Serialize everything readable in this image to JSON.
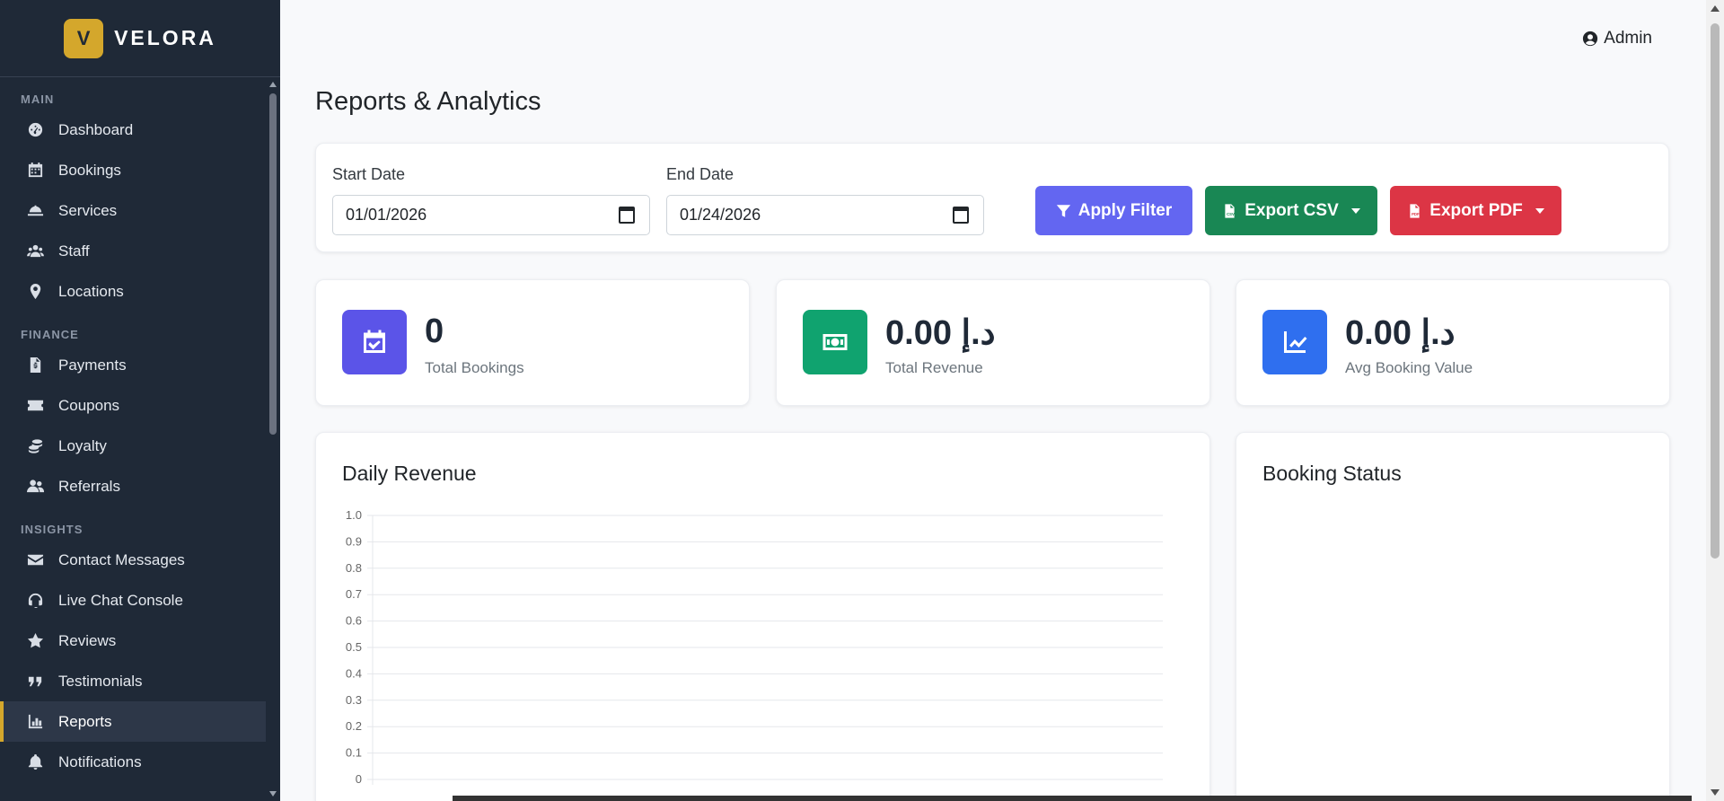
{
  "brand": {
    "logo_letter": "V",
    "name": "VELORA",
    "accent": "#d4a72c"
  },
  "sidebar": {
    "sections": [
      {
        "title": "MAIN",
        "items": [
          {
            "label": "Dashboard",
            "icon": "gauge-icon"
          },
          {
            "label": "Bookings",
            "icon": "calendar-icon"
          },
          {
            "label": "Services",
            "icon": "concierge-bell-icon"
          },
          {
            "label": "Staff",
            "icon": "users-icon"
          },
          {
            "label": "Locations",
            "icon": "map-pin-icon"
          }
        ]
      },
      {
        "title": "FINANCE",
        "items": [
          {
            "label": "Payments",
            "icon": "invoice-icon"
          },
          {
            "label": "Coupons",
            "icon": "ticket-icon"
          },
          {
            "label": "Loyalty",
            "icon": "coins-icon"
          },
          {
            "label": "Referrals",
            "icon": "user-friends-icon"
          }
        ]
      },
      {
        "title": "INSIGHTS",
        "items": [
          {
            "label": "Contact Messages",
            "icon": "envelope-icon"
          },
          {
            "label": "Live Chat Console",
            "icon": "headset-icon"
          },
          {
            "label": "Reviews",
            "icon": "star-icon"
          },
          {
            "label": "Testimonials",
            "icon": "quote-icon"
          },
          {
            "label": "Reports",
            "icon": "bar-chart-icon",
            "active": true
          },
          {
            "label": "Notifications",
            "icon": "bell-icon"
          }
        ]
      }
    ]
  },
  "topbar": {
    "user_label": "Admin"
  },
  "page": {
    "title": "Reports & Analytics"
  },
  "filter": {
    "start_label": "Start Date",
    "start_value": "01/01/2026",
    "end_label": "End Date",
    "end_value": "01/24/2026",
    "apply_label": "Apply Filter",
    "csv_label": "Export CSV",
    "pdf_label": "Export PDF",
    "colors": {
      "apply": "#6366f1",
      "csv": "#198754",
      "pdf": "#dc3545"
    }
  },
  "stats": [
    {
      "value": "0",
      "label": "Total Bookings",
      "icon": "calendar-check-icon",
      "color": "#5b54e8"
    },
    {
      "value": "0.00 د.إ",
      "label": "Total Revenue",
      "icon": "money-bill-icon",
      "color": "#10a36f"
    },
    {
      "value": "0.00 د.إ",
      "label": "Avg Booking Value",
      "icon": "chart-line-icon",
      "color": "#2f6fef"
    }
  ],
  "charts": {
    "daily_title": "Daily Revenue",
    "status_title": "Booking Status"
  },
  "chart_data": {
    "type": "line",
    "title": "Daily Revenue",
    "xlabel": "",
    "ylabel": "",
    "ylim": [
      0,
      1
    ],
    "y_ticks": [
      "1.0",
      "0.9",
      "0.8",
      "0.7",
      "0.6",
      "0.5",
      "0.4",
      "0.3",
      "0.2",
      "0.1",
      "0"
    ],
    "series": [],
    "grid": true
  }
}
